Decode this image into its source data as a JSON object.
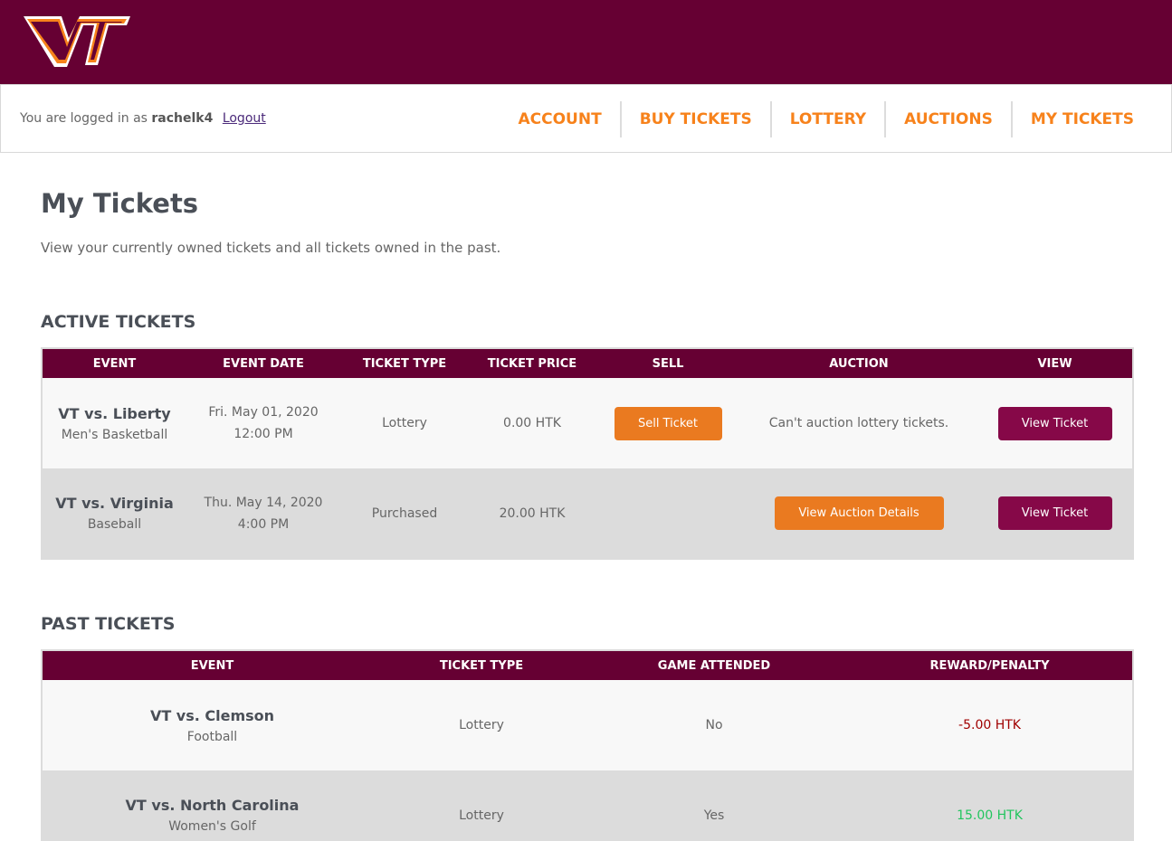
{
  "brand": {
    "logo_text": "VT",
    "colors": {
      "maroon": "#660033",
      "orange": "#f7821b",
      "button_orange": "#ea7a20",
      "button_maroon": "#860848"
    }
  },
  "session": {
    "prefix": "You are logged in as",
    "username": "rachelk4",
    "logout_label": "Logout"
  },
  "nav": {
    "items": [
      {
        "label": "ACCOUNT"
      },
      {
        "label": "BUY TICKETS"
      },
      {
        "label": "LOTTERY"
      },
      {
        "label": "AUCTIONS"
      },
      {
        "label": "MY TICKETS"
      }
    ]
  },
  "page": {
    "title": "My Tickets",
    "description": "View your currently owned tickets and all tickets owned in the past."
  },
  "active": {
    "title": "ACTIVE TICKETS",
    "headers": [
      "EVENT",
      "EVENT DATE",
      "TICKET TYPE",
      "TICKET PRICE",
      "SELL",
      "AUCTION",
      "VIEW"
    ],
    "rows": [
      {
        "event": "VT vs. Liberty",
        "sport": "Men's Basketball",
        "date": "Fri. May 01, 2020",
        "time": "12:00 PM",
        "type": "Lottery",
        "price": "0.00 HTK",
        "sell_label": "Sell Ticket",
        "auction_text": "Can't auction lottery tickets.",
        "view_label": "View Ticket"
      },
      {
        "event": "VT vs. Virginia",
        "sport": "Baseball",
        "date": "Thu. May 14, 2020",
        "time": "4:00 PM",
        "type": "Purchased",
        "price": "20.00 HTK",
        "auction_label": "View Auction Details",
        "view_label": "View Ticket"
      }
    ]
  },
  "past": {
    "title": "PAST TICKETS",
    "headers": [
      "EVENT",
      "TICKET TYPE",
      "GAME ATTENDED",
      "REWARD/PENALTY"
    ],
    "rows": [
      {
        "event": "VT vs. Clemson",
        "sport": "Football",
        "type": "Lottery",
        "attended": "No",
        "reward": "-5.00 HTK",
        "reward_color": "#a00000"
      },
      {
        "event": "VT vs. North Carolina",
        "sport": "Women's Golf",
        "type": "Lottery",
        "attended": "Yes",
        "reward": "15.00 HTK",
        "reward_color": "#22c55e"
      }
    ]
  }
}
